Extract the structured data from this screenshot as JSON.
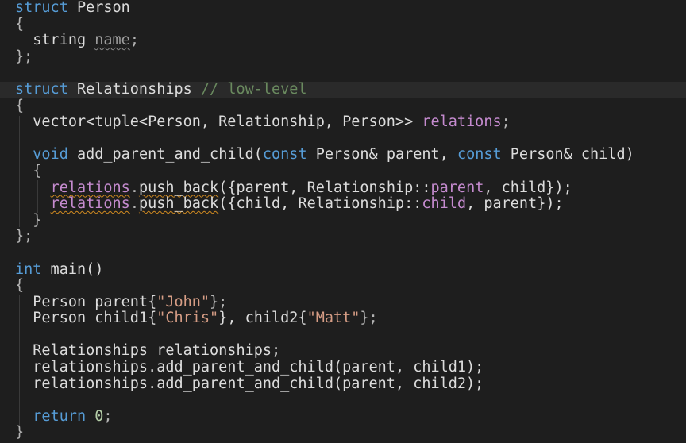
{
  "editor": {
    "lines": [
      [
        {
          "t": "struct",
          "c": "kw"
        },
        {
          "t": " ",
          "c": "plain"
        },
        {
          "t": "Person",
          "c": "type"
        }
      ],
      [
        {
          "t": "{",
          "c": "punc"
        }
      ],
      [
        {
          "t": "  string ",
          "c": "plain"
        },
        {
          "t": "name",
          "c": "squiggle-grey"
        },
        {
          "t": ";",
          "c": "punc"
        }
      ],
      [
        {
          "t": "};",
          "c": "punc"
        }
      ],
      [],
      [
        {
          "t": "struct",
          "c": "kw"
        },
        {
          "t": " Relationships ",
          "c": "type"
        },
        {
          "t": "// low-level",
          "c": "comment"
        }
      ],
      [
        {
          "t": "{",
          "c": "punc"
        }
      ],
      [
        {
          "t": "  vector<tuple<Person, Relationship, Person>> ",
          "c": "plain"
        },
        {
          "t": "relations",
          "c": "member"
        },
        {
          "t": ";",
          "c": "punc"
        }
      ],
      [],
      [
        {
          "t": "  ",
          "c": "plain"
        },
        {
          "t": "void",
          "c": "kw"
        },
        {
          "t": " add_parent_and_child(",
          "c": "plain"
        },
        {
          "t": "const",
          "c": "kw"
        },
        {
          "t": " Person& parent, ",
          "c": "plain"
        },
        {
          "t": "const",
          "c": "kw"
        },
        {
          "t": " Person& child)",
          "c": "plain"
        }
      ],
      [
        {
          "t": "  {",
          "c": "punc"
        }
      ],
      [
        {
          "t": "    ",
          "c": "plain"
        },
        {
          "t": "relations",
          "c": "member-sq"
        },
        {
          "t": ".",
          "c": "punc"
        },
        {
          "t": "push_back",
          "c": "plain-sq"
        },
        {
          "t": "({parent, Relationship::",
          "c": "plain"
        },
        {
          "t": "parent",
          "c": "member"
        },
        {
          "t": ", child});",
          "c": "plain"
        }
      ],
      [
        {
          "t": "    ",
          "c": "plain"
        },
        {
          "t": "relations",
          "c": "member-sq"
        },
        {
          "t": ".",
          "c": "punc"
        },
        {
          "t": "push_back",
          "c": "plain-sq"
        },
        {
          "t": "({child, Relationship::",
          "c": "plain"
        },
        {
          "t": "child",
          "c": "member"
        },
        {
          "t": ", parent});",
          "c": "plain"
        }
      ],
      [
        {
          "t": "  }",
          "c": "punc"
        }
      ],
      [
        {
          "t": "};",
          "c": "punc"
        }
      ],
      [],
      [
        {
          "t": "int",
          "c": "kw"
        },
        {
          "t": " main()",
          "c": "plain"
        }
      ],
      [
        {
          "t": "{",
          "c": "punc"
        }
      ],
      [
        {
          "t": "  Person parent{",
          "c": "plain"
        },
        {
          "t": "\"John\"",
          "c": "string"
        },
        {
          "t": "};",
          "c": "punc"
        }
      ],
      [
        {
          "t": "  Person child1{",
          "c": "plain"
        },
        {
          "t": "\"Chris\"",
          "c": "string"
        },
        {
          "t": "}, child2{",
          "c": "plain"
        },
        {
          "t": "\"Matt\"",
          "c": "string"
        },
        {
          "t": "};",
          "c": "punc"
        }
      ],
      [],
      [
        {
          "t": "  Relationships relationships;",
          "c": "plain"
        }
      ],
      [
        {
          "t": "  relationships.add_parent_and_child(parent, child1);",
          "c": "plain"
        }
      ],
      [
        {
          "t": "  relationships.add_parent_and_child(parent, child2);",
          "c": "plain"
        }
      ],
      [],
      [
        {
          "t": "  ",
          "c": "plain"
        },
        {
          "t": "return",
          "c": "kw"
        },
        {
          "t": " ",
          "c": "plain"
        },
        {
          "t": "0",
          "c": "number"
        },
        {
          "t": ";",
          "c": "punc"
        }
      ],
      [
        {
          "t": "}",
          "c": "punc"
        }
      ]
    ],
    "current_line": 5,
    "colors": {
      "background": "#1e1e1e",
      "keyword": "#569cd6",
      "member": "#c58bcf",
      "string": "#d69d85",
      "comment": "#6a8a5f",
      "squiggle_warning": "#d08a20",
      "squiggle_info": "#8a8a8a"
    }
  }
}
